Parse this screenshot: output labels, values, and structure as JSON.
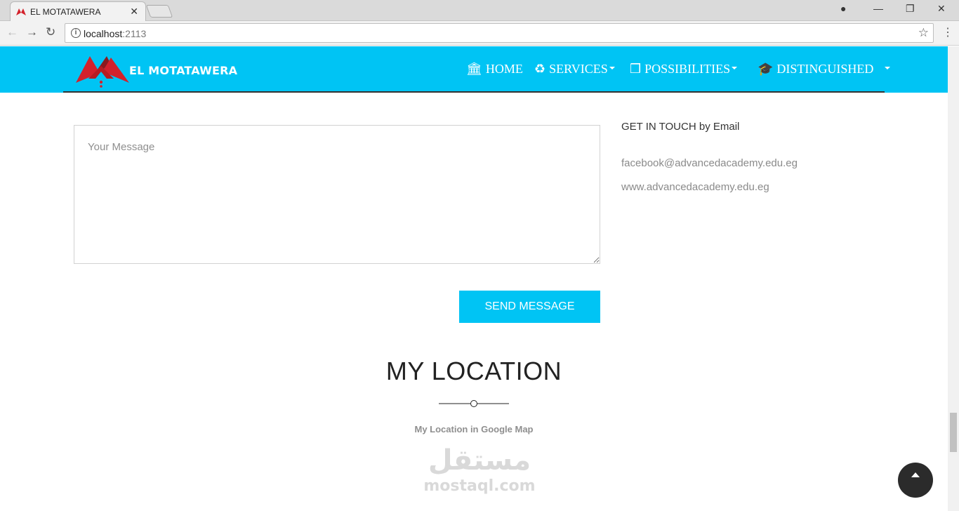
{
  "browser": {
    "tab_title": "EL MOTATAWERA",
    "url_host": "localhost",
    "url_port": ":2113"
  },
  "site": {
    "brand": "EL MOTATAWERA",
    "nav": [
      {
        "label": "HOME",
        "icon": "bank-icon",
        "dropdown": false
      },
      {
        "label": "SERVICES",
        "icon": "recycle-icon",
        "dropdown": true
      },
      {
        "label": "POSSIBILITIES",
        "icon": "cubes-icon",
        "dropdown": true
      },
      {
        "label": "DISTINGUISHED",
        "icon": "graduation-cap-icon",
        "dropdown": true
      }
    ]
  },
  "contact": {
    "message_placeholder": "Your Message",
    "send_label": "SEND MESSAGE",
    "get_in_touch": "GET IN TOUCH by Email",
    "email": "facebook@advancedacademy.edu.eg",
    "website": "www.advancedacademy.edu.eg"
  },
  "location": {
    "title": "MY LOCATION",
    "subtitle": "My Location in Google Map"
  },
  "watermark": {
    "arabic": "مستقل",
    "latin": "mostaql.com"
  },
  "colors": {
    "accent": "#00c4f4",
    "logo_red": "#d3212b",
    "scroll_top_bg": "#2b2b2b"
  }
}
